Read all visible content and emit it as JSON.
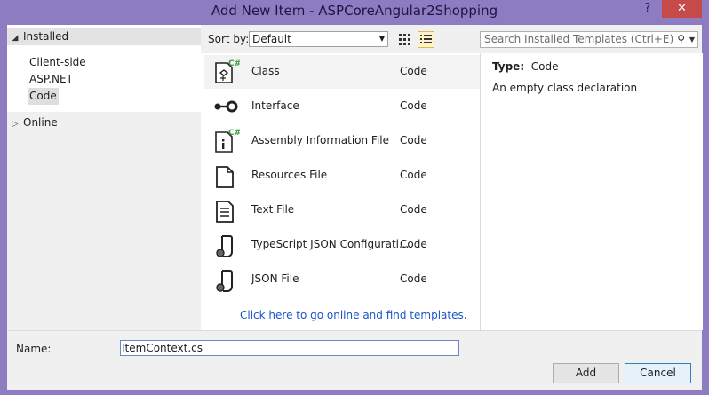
{
  "window": {
    "title": "Add New Item - ASPCoreAngular2Shopping",
    "help": "?",
    "close": "✕"
  },
  "tree": {
    "installed": "Installed",
    "children": [
      "Client-side",
      "ASP.NET",
      "Code"
    ],
    "online": "Online"
  },
  "toolbar": {
    "sort_label": "Sort by:",
    "sort_value": "Default",
    "search_placeholder": "Search Installed Templates (Ctrl+E)"
  },
  "items": [
    {
      "name": "Class",
      "category": "Code",
      "icon": "class-icon"
    },
    {
      "name": "Interface",
      "category": "Code",
      "icon": "interface-icon"
    },
    {
      "name": "Assembly Information File",
      "category": "Code",
      "icon": "assembly-info-icon"
    },
    {
      "name": "Resources File",
      "category": "Code",
      "icon": "resources-file-icon"
    },
    {
      "name": "Text File",
      "category": "Code",
      "icon": "text-file-icon"
    },
    {
      "name": "TypeScript JSON Configurati...",
      "category": "Code",
      "icon": "typescript-json-icon"
    },
    {
      "name": "JSON File",
      "category": "Code",
      "icon": "json-file-icon"
    }
  ],
  "online_link": "Click here to go online and find templates.",
  "details": {
    "type_label": "Type:",
    "type_value": "Code",
    "description": "An empty class declaration"
  },
  "bottom": {
    "name_label": "Name:",
    "name_value": "ItemContext.cs",
    "add": "Add",
    "cancel": "Cancel"
  }
}
